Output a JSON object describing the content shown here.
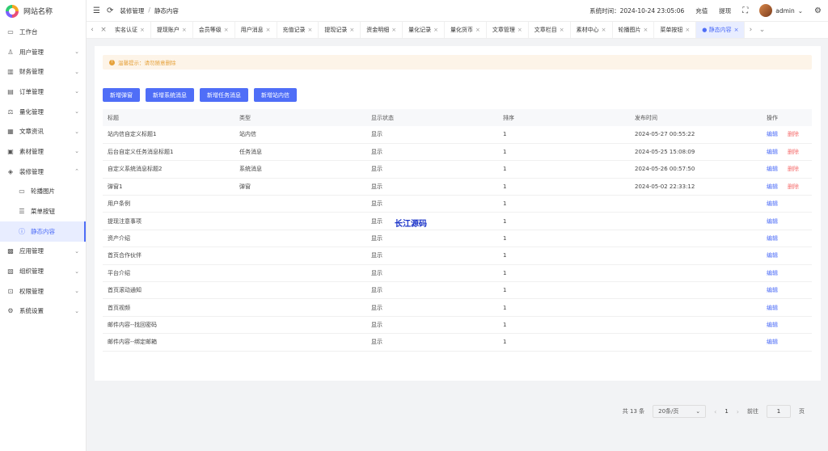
{
  "site": {
    "name": "网站名称"
  },
  "sidebar": {
    "items": [
      {
        "label": "工作台",
        "icon": "monitor-icon",
        "glyph": "▭",
        "sub": false,
        "expandable": false
      },
      {
        "label": "用户管理",
        "icon": "user-icon",
        "glyph": "♙",
        "sub": false,
        "expandable": true,
        "chev": "⌄"
      },
      {
        "label": "财务管理",
        "icon": "chart-icon",
        "glyph": "▥",
        "sub": false,
        "expandable": true,
        "chev": "⌄"
      },
      {
        "label": "订单管理",
        "icon": "order-icon",
        "glyph": "▤",
        "sub": false,
        "expandable": true,
        "chev": "⌄"
      },
      {
        "label": "量化管理",
        "icon": "scale-icon",
        "glyph": "⚖",
        "sub": false,
        "expandable": true,
        "chev": "⌄"
      },
      {
        "label": "文章资讯",
        "icon": "article-icon",
        "glyph": "▦",
        "sub": false,
        "expandable": true,
        "chev": "⌄"
      },
      {
        "label": "素材管理",
        "icon": "image-icon",
        "glyph": "▣",
        "sub": false,
        "expandable": true,
        "chev": "⌄"
      },
      {
        "label": "装修管理",
        "icon": "decor-icon",
        "glyph": "◈",
        "sub": false,
        "expandable": true,
        "chev": "⌃"
      },
      {
        "label": "轮播图片",
        "icon": "carousel-icon",
        "glyph": "▭",
        "sub": true,
        "expandable": false
      },
      {
        "label": "菜单按钮",
        "icon": "menu-list-icon",
        "glyph": "☰",
        "sub": true,
        "expandable": false
      },
      {
        "label": "静态内容",
        "icon": "info-icon",
        "glyph": "ⓘ",
        "sub": true,
        "expandable": false,
        "active": true
      },
      {
        "label": "应用管理",
        "icon": "app-icon",
        "glyph": "▩",
        "sub": false,
        "expandable": true,
        "chev": "⌄"
      },
      {
        "label": "组织管理",
        "icon": "org-icon",
        "glyph": "▧",
        "sub": false,
        "expandable": true,
        "chev": "⌄"
      },
      {
        "label": "权限管理",
        "icon": "lock-icon",
        "glyph": "⊡",
        "sub": false,
        "expandable": true,
        "chev": "⌄"
      },
      {
        "label": "系统设置",
        "icon": "gear-icon",
        "glyph": "⚙",
        "sub": false,
        "expandable": true,
        "chev": "⌄"
      }
    ]
  },
  "topbar": {
    "menu_icon": "☰",
    "refresh_icon": "⟳",
    "breadcrumb": [
      "装修管理",
      "静态内容"
    ],
    "breadcrumb_sep": "/",
    "system_time": "系统时间：2024-10-24 23:05:06",
    "recharge": "充值",
    "withdraw": "提现",
    "fullscreen_icon": "⛶",
    "username": "admin",
    "user_chev": "⌄",
    "settings_icon": "⚙"
  },
  "tabs": {
    "prev": "‹",
    "next": "›",
    "more": "⌄",
    "close_all": "×",
    "items": [
      {
        "label": "实名认证"
      },
      {
        "label": "提现账户"
      },
      {
        "label": "会员等级"
      },
      {
        "label": "用户消息"
      },
      {
        "label": "充值记录"
      },
      {
        "label": "提现记录"
      },
      {
        "label": "资金明细"
      },
      {
        "label": "量化记录"
      },
      {
        "label": "量化货币"
      },
      {
        "label": "文章管理"
      },
      {
        "label": "文章栏目"
      },
      {
        "label": "素材中心"
      },
      {
        "label": "轮播图片"
      },
      {
        "label": "菜单按钮"
      },
      {
        "label": "● 静态内容",
        "active": true
      }
    ]
  },
  "tip": {
    "icon": "!",
    "text": "温馨提示：请勿随意删除"
  },
  "buttons": [
    "新增弹窗",
    "新增系统消息",
    "新增任务消息",
    "新增站内信"
  ],
  "table": {
    "columns": [
      "标题",
      "类型",
      "显示状态",
      "排序",
      "发布时间",
      "操作"
    ],
    "edit_label": "编辑",
    "delete_label": "删除",
    "rows": [
      {
        "title": "站内信自定义标题1",
        "type": "站内信",
        "status": "显示",
        "sort": "1",
        "time": "2024-05-27 00:55:22",
        "deletable": true
      },
      {
        "title": "后台自定义任务消息标题1",
        "type": "任务消息",
        "status": "显示",
        "sort": "1",
        "time": "2024-05-25 15:08:09",
        "deletable": true
      },
      {
        "title": "自定义系统消息标题2",
        "type": "系统消息",
        "status": "显示",
        "sort": "1",
        "time": "2024-05-26 00:57:50",
        "deletable": true
      },
      {
        "title": "弹窗1",
        "type": "弹窗",
        "status": "显示",
        "sort": "1",
        "time": "2024-05-02 22:33:12",
        "deletable": true
      },
      {
        "title": "用户条例",
        "type": "",
        "status": "显示",
        "sort": "1",
        "time": "",
        "deletable": false
      },
      {
        "title": "提现注意事项",
        "type": "",
        "status": "显示",
        "sort": "1",
        "time": "",
        "deletable": false
      },
      {
        "title": "资产介绍",
        "type": "",
        "status": "显示",
        "sort": "1",
        "time": "",
        "deletable": false
      },
      {
        "title": "首页合作伙伴",
        "type": "",
        "status": "显示",
        "sort": "1",
        "time": "",
        "deletable": false
      },
      {
        "title": "平台介绍",
        "type": "",
        "status": "显示",
        "sort": "1",
        "time": "",
        "deletable": false
      },
      {
        "title": "首页滚动通知",
        "type": "",
        "status": "显示",
        "sort": "1",
        "time": "",
        "deletable": false
      },
      {
        "title": "首页视频",
        "type": "",
        "status": "显示",
        "sort": "1",
        "time": "",
        "deletable": false
      },
      {
        "title": "邮件内容--找回密码",
        "type": "",
        "status": "显示",
        "sort": "1",
        "time": "",
        "deletable": false
      },
      {
        "title": "邮件内容--绑定邮箱",
        "type": "",
        "status": "显示",
        "sort": "1",
        "time": "",
        "deletable": false
      }
    ]
  },
  "watermark": "长江源码",
  "pagination": {
    "total": "共 13 条",
    "page_size": "20条/页",
    "prev": "‹",
    "page": "1",
    "next": "›",
    "goto_label": "前往",
    "goto_value": "1",
    "goto_suffix": "页"
  }
}
